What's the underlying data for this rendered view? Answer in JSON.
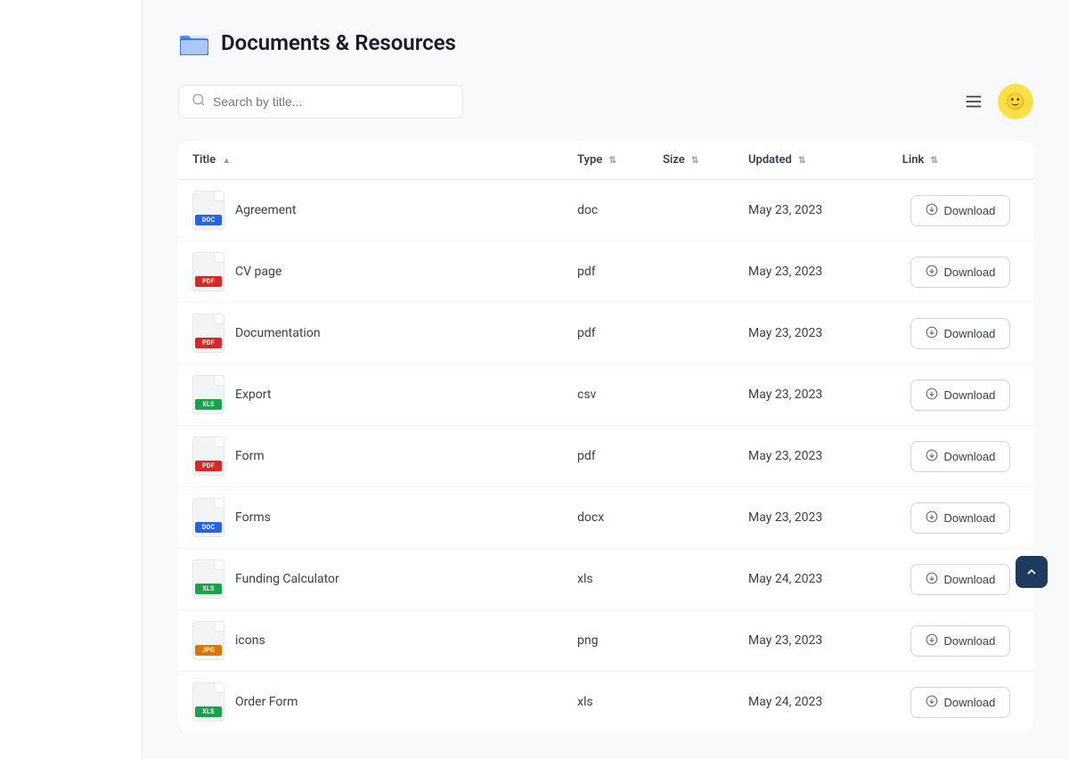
{
  "page": {
    "title": "Documents & Resources",
    "sidebar": {}
  },
  "toolbar": {
    "search_placeholder": "Search by title...",
    "menu_icon": "≡",
    "avatar_emoji": "🙂"
  },
  "table": {
    "columns": [
      {
        "key": "title",
        "label": "Title"
      },
      {
        "key": "type",
        "label": "Type"
      },
      {
        "key": "size",
        "label": "Size"
      },
      {
        "key": "updated",
        "label": "Updated"
      },
      {
        "key": "link",
        "label": "Link"
      }
    ],
    "download_label": "Download",
    "rows": [
      {
        "title": "Agreement",
        "type": "doc",
        "size": "",
        "updated": "May 23, 2023",
        "badge": "DOC",
        "badge_class": "badge-doc"
      },
      {
        "title": "CV page",
        "type": "pdf",
        "size": "",
        "updated": "May 23, 2023",
        "badge": "PDF",
        "badge_class": "badge-pdf"
      },
      {
        "title": "Documentation",
        "type": "pdf",
        "size": "",
        "updated": "May 23, 2023",
        "badge": "PDF",
        "badge_class": "badge-pdf"
      },
      {
        "title": "Export",
        "type": "csv",
        "size": "",
        "updated": "May 23, 2023",
        "badge": "XLS",
        "badge_class": "badge-xls"
      },
      {
        "title": "Form",
        "type": "pdf",
        "size": "",
        "updated": "May 23, 2023",
        "badge": "PDF",
        "badge_class": "badge-pdf"
      },
      {
        "title": "Forms",
        "type": "docx",
        "size": "",
        "updated": "May 23, 2023",
        "badge": "DOC",
        "badge_class": "badge-doc"
      },
      {
        "title": "Funding Calculator",
        "type": "xls",
        "size": "",
        "updated": "May 24, 2023",
        "badge": "XLS",
        "badge_class": "badge-xls"
      },
      {
        "title": "icons",
        "type": "png",
        "size": "",
        "updated": "May 23, 2023",
        "badge": "JPG",
        "badge_class": "badge-jpg"
      },
      {
        "title": "Order Form",
        "type": "xls",
        "size": "",
        "updated": "May 24, 2023",
        "badge": "XLS",
        "badge_class": "badge-xls"
      }
    ]
  }
}
